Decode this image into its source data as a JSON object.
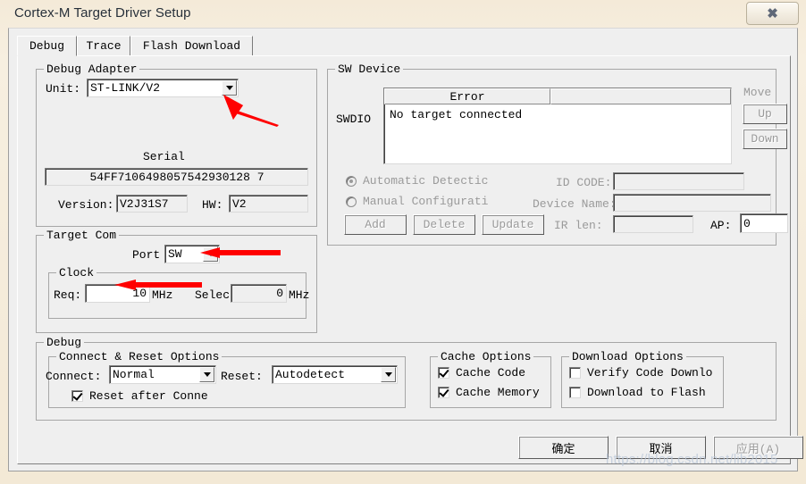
{
  "window": {
    "title": "Cortex-M Target Driver Setup",
    "close_glyph": "✖"
  },
  "tabs": [
    {
      "label": "Debug",
      "active": true
    },
    {
      "label": "Trace",
      "active": false
    },
    {
      "label": "Flash Download",
      "active": false
    }
  ],
  "debug_adapter": {
    "caption": "Debug Adapter",
    "unit_label": "Unit:",
    "unit_value": "ST-LINK/V2",
    "serial_label": "Serial",
    "serial_value": "54FF7106498057542930128 7",
    "version_label": "Version:",
    "version_value": "V2J31S7",
    "hw_label": "HW:",
    "hw_value": "V2"
  },
  "target_com": {
    "caption": "Target Com",
    "port_label": "Port",
    "port_value": "SW",
    "clock_caption": "Clock",
    "req_label": "Req:",
    "req_value": "10",
    "req_unit": "MHz",
    "selected_label": "Selected",
    "selected_value": "0",
    "selected_unit": "MHz"
  },
  "sw_device": {
    "caption": "SW Device",
    "swdio_label": "SWDIO",
    "col_error": "Error",
    "col_blank": "",
    "row_error": "No target connected",
    "move_label": "Move",
    "up_label": "Up",
    "down_label": "Down",
    "automatic_detection": "Automatic Detectic",
    "manual_configuration": "Manual Configurati",
    "add_label": "Add",
    "delete_label": "Delete",
    "update_label": "Update",
    "idcode_label": "ID CODE:",
    "idcode_value": "",
    "device_name_label": "Device Name:",
    "device_name_value": "",
    "irlen_label": "IR len:",
    "irlen_value": "",
    "ap_label": "AP:",
    "ap_value": "0"
  },
  "debug_group": {
    "caption": "Debug",
    "connect_reset": {
      "caption": "Connect & Reset Options",
      "connect_label": "Connect:",
      "connect_value": "Normal",
      "reset_label": "Reset:",
      "reset_value": "Autodetect",
      "reset_after_connect": "Reset after Conne"
    },
    "cache_options": {
      "caption": "Cache Options",
      "cache_code": "Cache Code",
      "cache_code_checked": true,
      "cache_memory": "Cache Memory",
      "cache_memory_checked": true
    },
    "download_options": {
      "caption": "Download Options",
      "verify_code_download": "Verify Code Downlo",
      "verify_checked": false,
      "download_to_flash": "Download to Flash",
      "download_checked": false
    }
  },
  "footer": {
    "ok_label": "确定",
    "cancel_label": "取消",
    "apply_label": "应用(A)"
  },
  "watermark": "https://blog.csdn.net/lib2015",
  "colors": {
    "titlebar": "#f3e9d6",
    "dialog": "#efefef",
    "annotation": "#ff0000",
    "disabled_text": "#9a9a9a"
  }
}
